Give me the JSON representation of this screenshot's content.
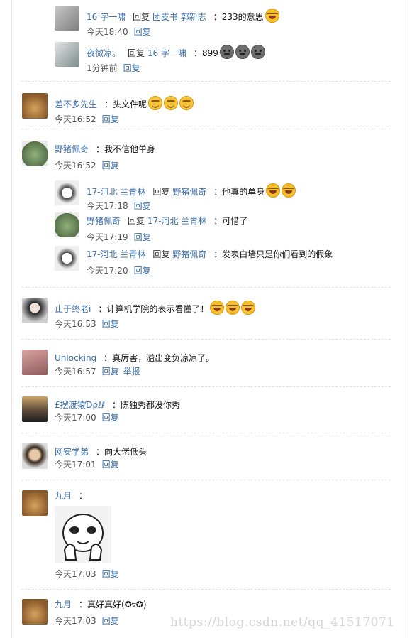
{
  "ui": {
    "reply": "回复",
    "report": "举报"
  },
  "colors": {
    "link": "#3c6ea8",
    "divider": "#e1e1e1"
  },
  "comments": [
    {
      "user": "16 字一啸",
      "target": "团支书 郭新志",
      "text": "233的意思",
      "emojis": [
        "laugh"
      ],
      "time": "今天18:40",
      "avatar_icon": "cartoon-avatar"
    },
    {
      "user": "夜微凉。",
      "target": "16 字一啸",
      "text": "899",
      "emojis": [
        "dark-face",
        "dark-face",
        "dark-face"
      ],
      "time": "1分钟前",
      "avatar_icon": "photo-avatar"
    },
    {
      "user": "差不多先生",
      "text": "头文件呢",
      "emojis": [
        "smile",
        "smile",
        "smile"
      ],
      "time": "今天16:52",
      "avatar_icon": "dog-avatar"
    },
    {
      "user": "野猪佩奇",
      "text": "我不信他单身",
      "time": "今天16:52",
      "avatar_icon": "frog-avatar"
    },
    {
      "user": "17-河北 兰青林",
      "target": "野猪佩奇",
      "text": "他真的单身",
      "emojis": [
        "laugh",
        "laugh"
      ],
      "time": "今天17:18",
      "avatar_icon": "dog-sketch-avatar"
    },
    {
      "user": "野猪佩奇",
      "target": "17-河北 兰青林",
      "text": "可惜了",
      "time": "今天17:19",
      "avatar_icon": "frog-avatar"
    },
    {
      "user": "17-河北 兰青林",
      "target": "野猪佩奇",
      "text": "发表白墙只是你们看到的假象",
      "time": "今天17:20",
      "avatar_icon": "dog-sketch-avatar"
    },
    {
      "user": "止于终老i",
      "text": "计算机学院的表示看懂了！",
      "emojis": [
        "laugh",
        "laugh",
        "laugh"
      ],
      "time": "今天16:53",
      "avatar_icon": "girl-avatar"
    },
    {
      "user": "Unlocking",
      "text": "真厉害，溢出变负凉凉了。",
      "time": "今天16:57",
      "report": true,
      "avatar_icon": "portrait-avatar"
    },
    {
      "user": "£摆渡猿Ɗρℓℓ",
      "text": "陈独秀都没你秀",
      "time": "今天17:00",
      "avatar_icon": "silhouette-avatar"
    },
    {
      "user": "网安学弟",
      "text": "向大佬低头",
      "time": "今天17:01",
      "avatar_icon": "man-avatar"
    },
    {
      "user": "九月",
      "text": "",
      "time": "今天17:03",
      "sticker_icon": "panda-meme-sticker",
      "avatar_icon": "dog-avatar"
    },
    {
      "user": "九月",
      "text": "真好真好(✪▿✪)",
      "time": "今天17:03",
      "avatar_icon": "dog-avatar"
    }
  ],
  "watermark": "https://blog.csdn.net/qq_41517071"
}
